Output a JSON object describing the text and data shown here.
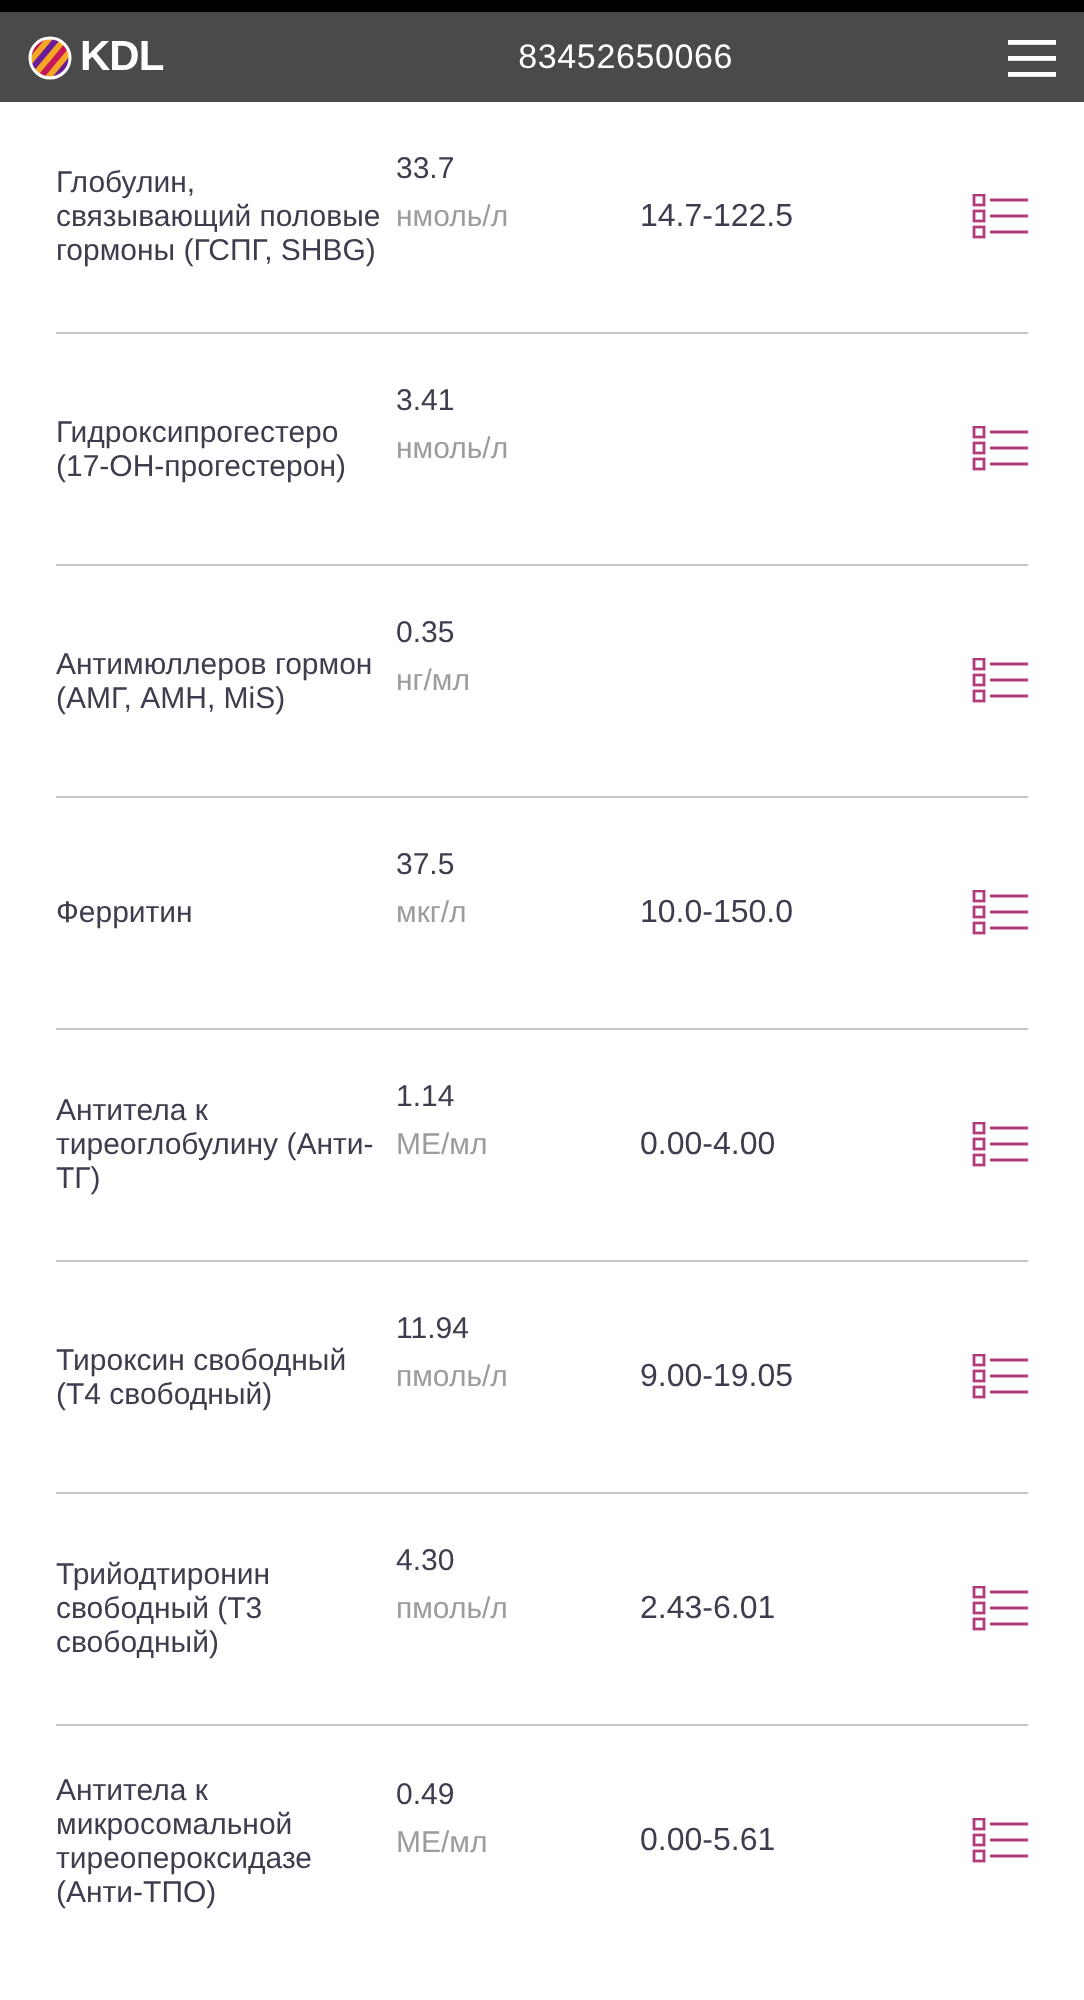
{
  "header": {
    "logo_text": "KDL",
    "phone": "83452650066"
  },
  "results": [
    {
      "name": "Глобулин, связывающий половые гормоны (ГСПГ, SHBG)",
      "value": "33.7",
      "unit": "нмоль/л",
      "range": "14.7-122.5"
    },
    {
      "name": "Гидроксипрогестеро (17-ОН-прогестерон)",
      "value": "3.41",
      "unit": "нмоль/л"
    },
    {
      "name": "Антимюллеров гормон (АМГ, AMH, MiS)",
      "value": "0.35",
      "unit": "нг/мл"
    },
    {
      "name": "Ферритин",
      "value": "37.5",
      "unit": "мкг/л",
      "range": "10.0-150.0"
    },
    {
      "name": "Антитела к тиреоглобулину (Анти-ТГ)",
      "value": "1.14",
      "unit": "МЕ/мл",
      "range": "0.00-4.00"
    },
    {
      "name": "Тироксин свободный (Т4 свободный)",
      "value": "11.94",
      "unit": "пмоль/л",
      "range": "9.00-19.05"
    },
    {
      "name": "Трийодтиронин свободный (Т3 свободный)",
      "value": "4.30",
      "unit": "пмоль/л",
      "range": "2.43-6.01"
    },
    {
      "name": "Антитела к микросомальной тиреопероксидазе (Анти-ТПО)",
      "value": "0.49",
      "unit": "МЕ/мл",
      "range": "0.00-5.61"
    }
  ]
}
